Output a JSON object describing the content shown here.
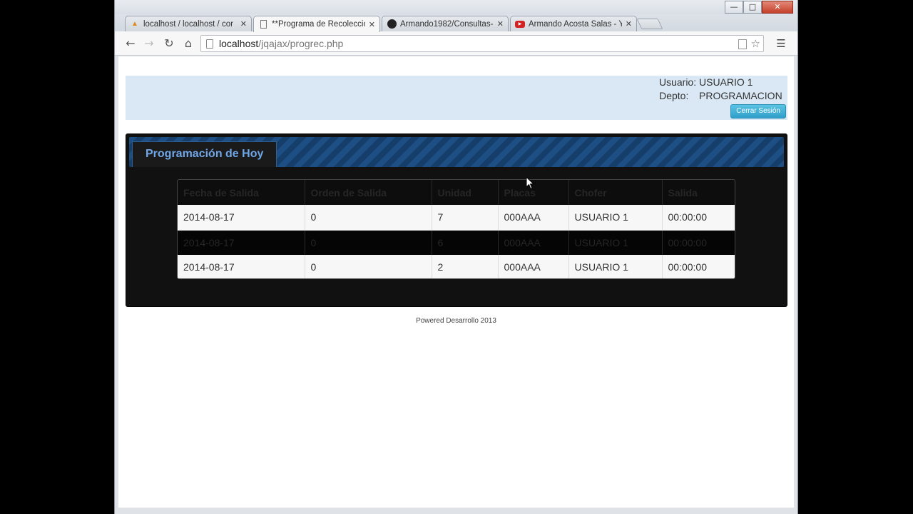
{
  "browser": {
    "tabs": [
      {
        "label": "localhost / localhost / cor",
        "icon": "phpmyadmin-icon"
      },
      {
        "label": "**Programa de Recoleccio",
        "icon": "page-icon"
      },
      {
        "label": "Armando1982/Consultas-",
        "icon": "github-icon"
      },
      {
        "label": "Armando Acosta Salas - Y",
        "icon": "youtube-icon"
      }
    ],
    "url_host": "localhost",
    "url_path": "/jqajax/progrec.php"
  },
  "user": {
    "usuario_label": "Usuario:",
    "usuario_value": "USUARIO 1",
    "depto_label": "Depto:",
    "depto_value": "PROGRAMACION",
    "logout_label": "Cerrar Sesión"
  },
  "panel": {
    "title": "Programación de Hoy"
  },
  "table": {
    "headers": [
      "Fecha de Salida",
      "Orden de Salida",
      "Unidad",
      "Placas",
      "Chofer",
      "Salida"
    ],
    "rows": [
      [
        "2014-08-17",
        "0",
        "7",
        "000AAA",
        "USUARIO 1",
        "00:00:00"
      ],
      [
        "2014-08-17",
        "0",
        "6",
        "000AAA",
        "USUARIO 1",
        "00:00:00"
      ],
      [
        "2014-08-17",
        "0",
        "2",
        "000AAA",
        "USUARIO 1",
        "00:00:00"
      ]
    ]
  },
  "footer": {
    "text": "Powered Desarrollo 2013"
  },
  "colors": {
    "panel_header": "#1d4e84",
    "panel_title": "#6fa7e8",
    "userbar": "#d9e8f4",
    "logout_button": "#2f9fc9"
  }
}
